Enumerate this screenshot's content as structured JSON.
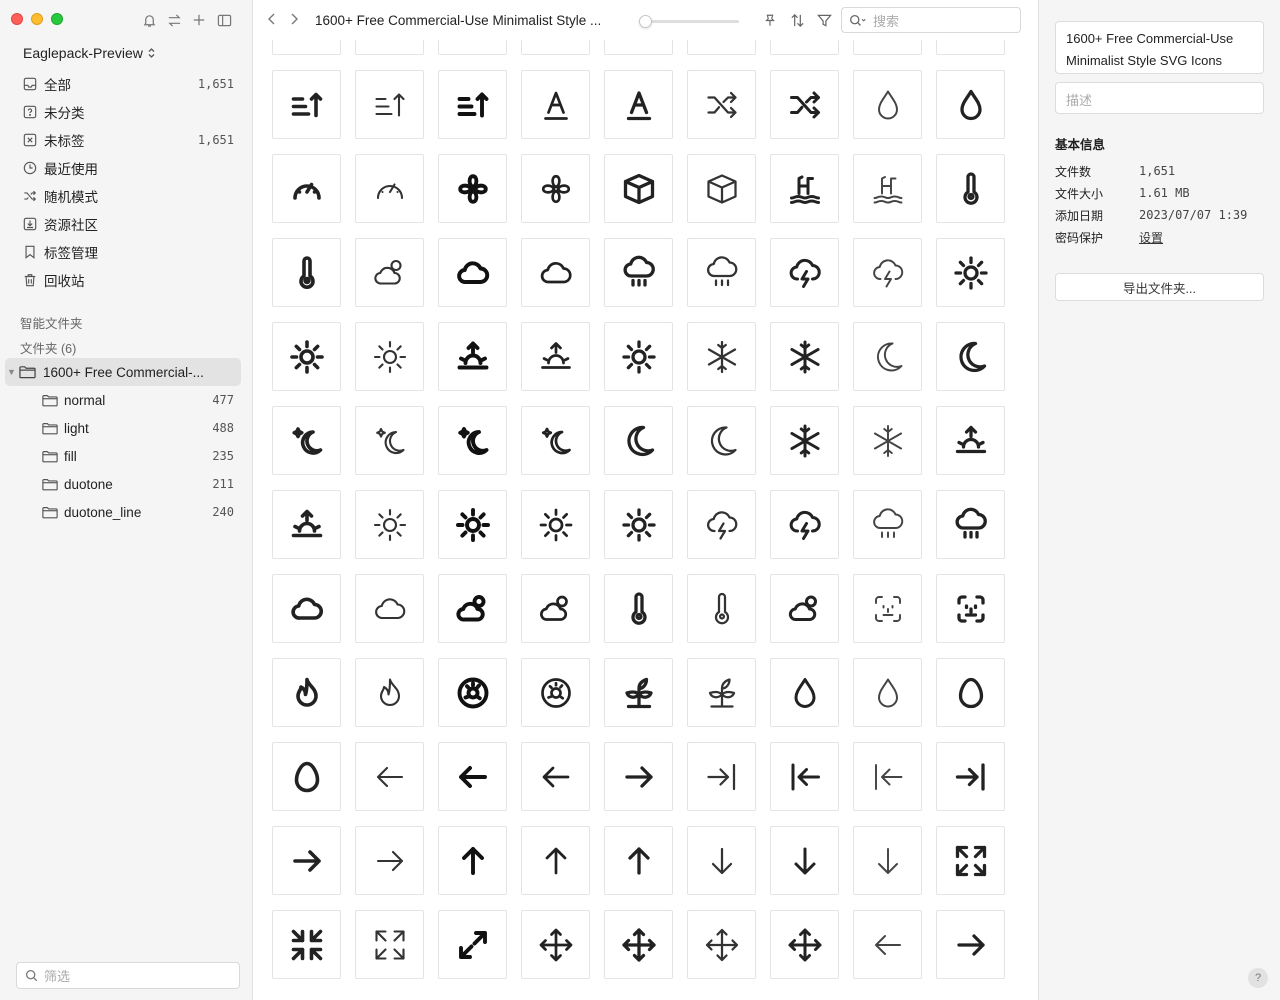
{
  "sidebar": {
    "library_name": "Eaglepack-Preview",
    "items": [
      {
        "label": "全部",
        "count": "1,651",
        "icon": "inbox-icon"
      },
      {
        "label": "未分类",
        "count": "",
        "icon": "question-box-icon"
      },
      {
        "label": "未标签",
        "count": "1,651",
        "icon": "untagged-icon"
      },
      {
        "label": "最近使用",
        "count": "",
        "icon": "clock-icon"
      },
      {
        "label": "随机模式",
        "count": "",
        "icon": "shuffle-icon"
      },
      {
        "label": "资源社区",
        "count": "",
        "icon": "download-box-icon"
      },
      {
        "label": "标签管理",
        "count": "",
        "icon": "bookmark-icon"
      },
      {
        "label": "回收站",
        "count": "",
        "icon": "trash-icon"
      }
    ],
    "smart_folders_label": "智能文件夹",
    "folders_label": "文件夹 (6)",
    "root_folder": "1600+ Free Commercial-...",
    "subfolders": [
      {
        "label": "normal",
        "count": "477"
      },
      {
        "label": "light",
        "count": "488"
      },
      {
        "label": "fill",
        "count": "235"
      },
      {
        "label": "duotone",
        "count": "211"
      },
      {
        "label": "duotone_line",
        "count": "240"
      }
    ],
    "filter_placeholder": "筛选"
  },
  "toolbar": {
    "title": "1600+ Free Commercial-Use Minimalist Style ...",
    "search_placeholder": "搜索"
  },
  "inspector": {
    "name": "1600+ Free Commercial-Use Minimalist Style SVG Icons",
    "desc_placeholder": "描述",
    "info_title": "基本信息",
    "rows": [
      {
        "key": "文件数",
        "value": "1,651"
      },
      {
        "key": "文件大小",
        "value": "1.61 MB"
      },
      {
        "key": "添加日期",
        "value": "2023/07/07 1:39"
      },
      {
        "key": "密码保护",
        "value": "设置"
      }
    ],
    "export_label": "导出文件夹...",
    "help_label": "?"
  },
  "icons": [
    "sort-up-down-icon",
    "sort-up-down-icon",
    "line-height-icon",
    "line-height-icon",
    "sort-lines-icon",
    "sort-lines-icon",
    "sort-desc-icon",
    "sort-desc-icon",
    "sort-asc-icon",
    "sort-asc-icon",
    "sort-asc-icon",
    "sort-asc-icon",
    "text-underline-icon",
    "text-underline-icon",
    "shuffle-icon",
    "shuffle-icon",
    "drop-icon",
    "drop-icon",
    "gauge-icon",
    "gauge-icon",
    "fan-icon",
    "fan-icon",
    "box-icon",
    "box-icon",
    "pool-icon",
    "pool-icon",
    "thermometer-icon",
    "thermometer-icon",
    "cloud-sun-icon",
    "cloud-icon",
    "cloud-icon",
    "cloud-rain-icon",
    "cloud-rain-icon",
    "cloud-lightning-icon",
    "cloud-lightning-icon",
    "sun-icon",
    "sun-icon",
    "sun-icon",
    "sunrise-icon",
    "sunrise-icon",
    "sun-icon",
    "snowflake-icon",
    "snowflake-icon",
    "moon-icon",
    "moon-icon",
    "moon-star-icon",
    "moon-star-icon",
    "moon-star-icon",
    "moon-star-icon",
    "moon-icon",
    "moon-icon",
    "snowflake-icon",
    "snowflake-icon",
    "sunrise-icon",
    "sunrise-icon",
    "sun-icon",
    "sun-icon",
    "sun-icon",
    "sun-icon",
    "cloud-lightning-icon",
    "cloud-lightning-icon",
    "cloud-rain-icon",
    "cloud-rain-icon",
    "cloud-icon",
    "cloud-icon",
    "cloud-sun-icon",
    "cloud-sun-icon",
    "thermometer-icon",
    "thermometer-icon",
    "cloud-sun-icon",
    "face-scan-icon",
    "face-scan-icon",
    "flame-icon",
    "flame-icon",
    "donut-icon",
    "donut-icon",
    "plant-icon",
    "plant-icon",
    "drop-icon",
    "drop-icon",
    "egg-icon",
    "egg-icon",
    "arrow-left-icon",
    "arrow-left-icon",
    "arrow-left-icon",
    "arrow-right-icon",
    "arrow-right-to-line-icon",
    "arrow-left-from-line-icon",
    "arrow-left-from-line-icon",
    "arrow-right-to-line-icon",
    "arrow-right-icon",
    "arrow-right-icon",
    "arrow-up-icon",
    "arrow-up-icon",
    "arrow-up-icon",
    "arrow-down-icon",
    "arrow-down-icon",
    "arrow-down-icon",
    "expand-icon",
    "collapse-icon",
    "expand-icon",
    "maximize-icon",
    "move-icon",
    "move-icon",
    "move-icon",
    "move-icon",
    "arrow-left-icon",
    "arrow-right-icon"
  ]
}
